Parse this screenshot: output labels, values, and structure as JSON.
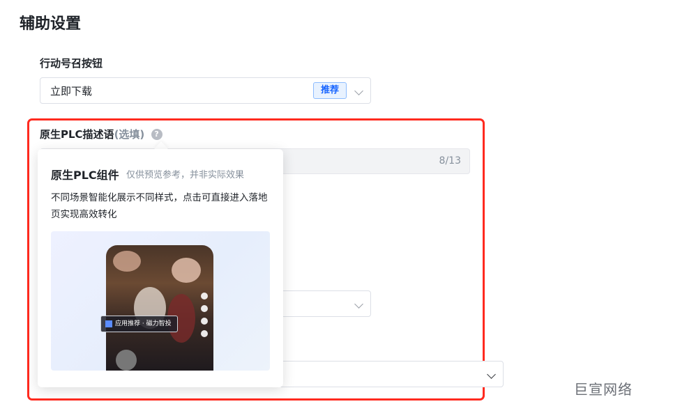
{
  "section": {
    "title": "辅助设置"
  },
  "cta": {
    "label": "行动号召按钮",
    "value": "立即下载",
    "badge": "推荐"
  },
  "plc": {
    "label": "原生PLC描述语",
    "optional": "(选填)",
    "help_icon": "?",
    "counter": "8/13"
  },
  "popover": {
    "title": "原生PLC组件",
    "subtitle": "仅供预览参考，并非实际效果",
    "description": "不同场景智能化展示不同样式，点击可直接进入落地页实现高效转化",
    "chip_label": "应用推荐 · 磁力智投"
  },
  "watermark": "巨宣网络",
  "colors": {
    "accent": "#1664ff",
    "highlight_border": "#ff2a1f"
  }
}
